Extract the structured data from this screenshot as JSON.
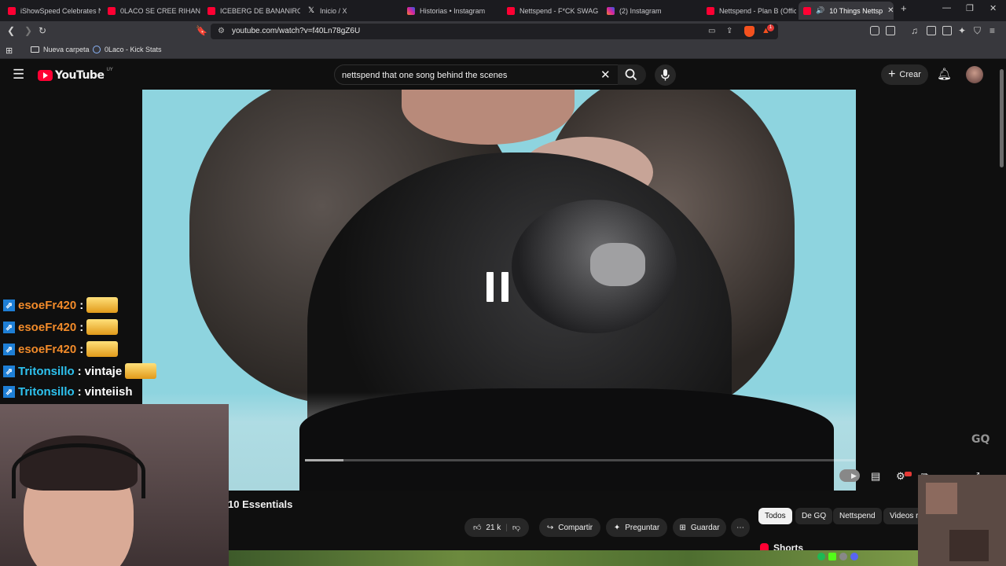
{
  "tabs": [
    {
      "title": "iShowSpeed Celebrates N",
      "favicon": "youtube-favicon",
      "color": "#ff0033"
    },
    {
      "title": "0LACO SE CREE RIHANNA",
      "favicon": "youtube-favicon",
      "color": "#ff0033"
    },
    {
      "title": "ICEBERG DE BANANIROU",
      "favicon": "youtube-favicon",
      "color": "#ff0033"
    },
    {
      "title": "Inicio / X",
      "favicon": "x-favicon",
      "color": "#ffffff"
    },
    {
      "title": "Historias • Instagram",
      "favicon": "instagram-favicon",
      "color": "#d6249f"
    },
    {
      "title": "Nettspend - F*CK SWAG (",
      "favicon": "youtube-favicon",
      "color": "#ff0033"
    },
    {
      "title": "(2) Instagram",
      "favicon": "instagram-favicon",
      "color": "#d6249f"
    },
    {
      "title": "Nettspend - Plan B (Offici",
      "favicon": "youtube-favicon",
      "color": "#ff0033"
    },
    {
      "title": "10 Things Nettsp",
      "favicon": "youtube-favicon",
      "color": "#ff0033",
      "active": true
    }
  ],
  "browser": {
    "url": "youtube.com/watch?v=f40Ln78gZ6U",
    "new_tab": "+",
    "shield_badge": "1"
  },
  "bookmarks": [
    {
      "label": "Nueva carpeta",
      "icon": "folder-icon"
    },
    {
      "label": "0Laco - Kick Stats",
      "icon": "kick-icon"
    }
  ],
  "youtube": {
    "logo_text": "YouTube",
    "region": "UY",
    "search_query": "nettspend that one song behind the scenes",
    "create_label": "Crear"
  },
  "player": {
    "progress": 0.07,
    "watermark": "GQ",
    "state": "paused"
  },
  "chat": [
    {
      "user": "esoeFr420",
      "msg": "",
      "emote": true,
      "color": "#f28b2a"
    },
    {
      "user": "esoeFr420",
      "msg": "",
      "emote": true,
      "color": "#f28b2a"
    },
    {
      "user": "esoeFr420",
      "msg": "",
      "emote": true,
      "color": "#f28b2a"
    },
    {
      "user": "Tritonsillo",
      "msg": "vintaje",
      "emote": true,
      "color": "#2ec3f0"
    },
    {
      "user": "Tritonsillo",
      "msg": "vinteiish",
      "emote": false,
      "color": "#2ec3f0"
    }
  ],
  "video": {
    "title_visible": "10 Essentials",
    "likes": "21 k",
    "share": "Compartir",
    "ask": "Preguntar",
    "save": "Guardar"
  },
  "chips": [
    "Todos",
    "De GQ",
    "Nettspend",
    "Videos r"
  ],
  "shorts_label": "Shorts"
}
